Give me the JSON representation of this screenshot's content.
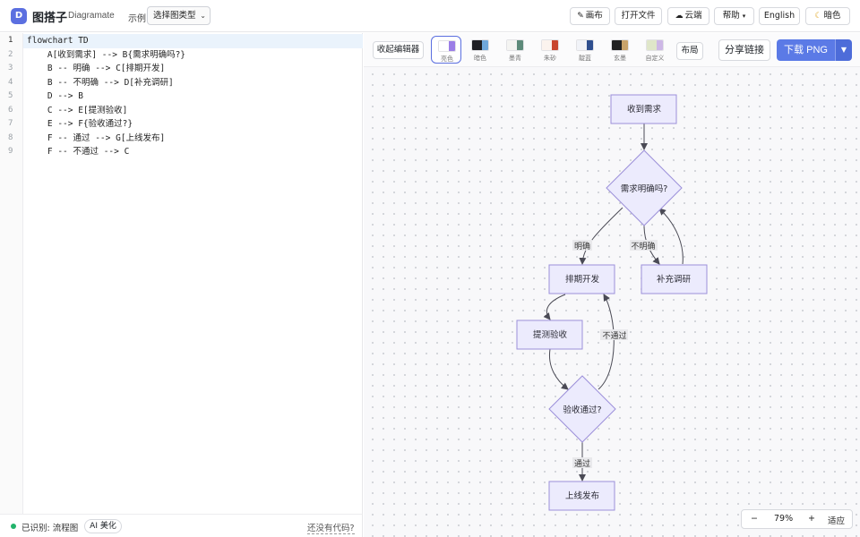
{
  "app": {
    "logo_letter": "D",
    "name": "图搭子",
    "subtitle": "Diagramate"
  },
  "topbar": {
    "example_label": "示例",
    "example_select": "选择图类型",
    "canvas_btn": "画布",
    "open_btn": "打开文件",
    "cloud_btn": "云端",
    "help_btn": "帮助",
    "lang_btn": "English",
    "dark_btn": "暗色"
  },
  "editor": {
    "lines": [
      "flowchart TD",
      "    A[收到需求] --> B{需求明确吗?}",
      "    B -- 明确 --> C[排期开发]",
      "    B -- 不明确 --> D[补充调研]",
      "    D --> B",
      "    C --> E[提测验收]",
      "    E --> F{验收通过?}",
      "    F -- 通过 --> G[上线发布]",
      "    F -- 不通过 --> C"
    ]
  },
  "status": {
    "detected": "已识别: 流程图",
    "ai_button": "AI 美化",
    "no_code": "还没有代码?"
  },
  "toolbar": {
    "collapse": "收起编辑器",
    "themes": [
      {
        "name": "亮色",
        "c1": "#ffffff",
        "c2": "#9b7ee6",
        "selected": true
      },
      {
        "name": "暗色",
        "c1": "#1e1f24",
        "c2": "#6fa8dc"
      },
      {
        "name": "墨青",
        "c1": "#f4f4f2",
        "c2": "#5d8a7a"
      },
      {
        "name": "朱砂",
        "c1": "#fbf3ee",
        "c2": "#c8462f"
      },
      {
        "name": "靛蓝",
        "c1": "#f1f3f8",
        "c2": "#2f4f8f"
      },
      {
        "name": "玄墨",
        "c1": "#222222",
        "c2": "#c9a36a"
      },
      {
        "name": "自定义",
        "c1": "#dfe6c9",
        "c2": "#cdb7e6"
      }
    ],
    "layout": "布局",
    "share": "分享链接",
    "download": "下载 PNG"
  },
  "diagram": {
    "nodes": {
      "A": "收到需求",
      "B": "需求明确吗?",
      "C": "排期开发",
      "D": "补充调研",
      "E": "提测验收",
      "F": "验收通过?",
      "G": "上线发布"
    },
    "edge_labels": {
      "b_c": "明确",
      "b_d": "不明确",
      "f_c": "不通过",
      "f_g": "通过"
    },
    "colors": {
      "node_fill": "#ecebfd",
      "node_stroke": "#9b8fd9",
      "edge": "#4a4a55"
    }
  },
  "zoom": {
    "minus": "−",
    "level": "79%",
    "plus": "+",
    "fit": "适应"
  }
}
